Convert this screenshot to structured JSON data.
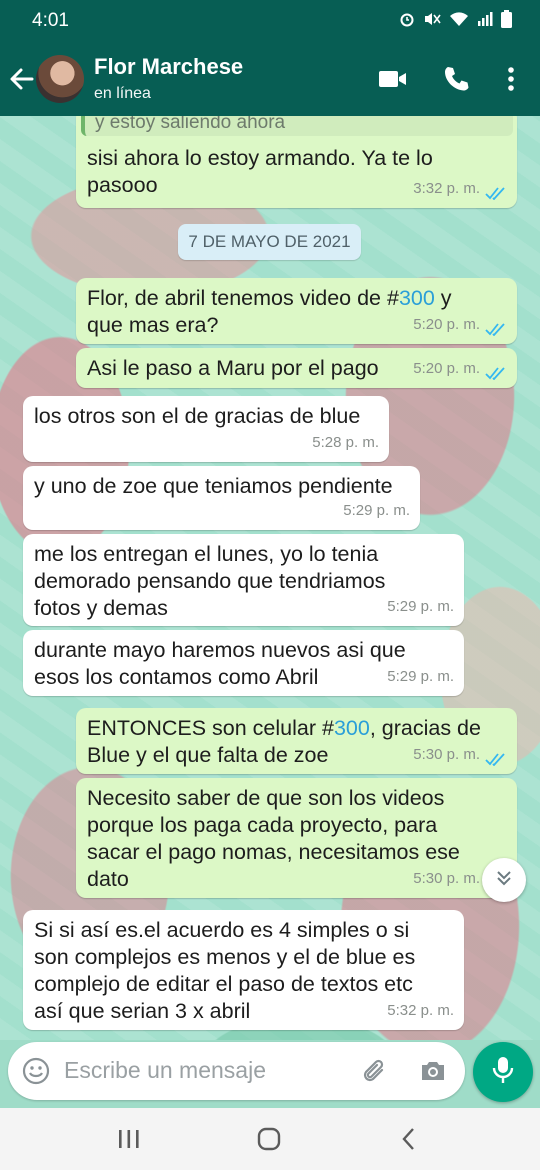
{
  "status_bar": {
    "time": "4:01"
  },
  "header": {
    "contact_name": "Flor Marchese",
    "contact_status": "en línea"
  },
  "messages": {
    "m0": {
      "quote": "y estoy saliendo ahora",
      "line1": "sisi ahora lo estoy armando. Ya te lo",
      "line2": "pasooo",
      "time": "3:32 p. m."
    },
    "date_chip": "7 DE MAYO DE 2021",
    "m1": {
      "pre": "Flor, de abril tenemos video de #",
      "num": "300",
      "post": " y",
      "line2": "que mas era?",
      "time": "5:20 p. m."
    },
    "m2": {
      "text": "Asi le paso a Maru por el pago",
      "time": "5:20 p. m."
    },
    "m3": {
      "text": "los otros son el de gracias de blue",
      "time": "5:28 p. m."
    },
    "m4": {
      "text": "y uno de zoe que teniamos pendiente",
      "time": "5:29 p. m."
    },
    "m5": {
      "line1": "me los entregan el lunes, yo lo tenia",
      "line2": "demorado pensando que tendriamos",
      "line3": "fotos y demas",
      "time": "5:29 p. m."
    },
    "m6": {
      "line1": "durante mayo haremos nuevos asi que",
      "line2": "esos los contamos como Abril",
      "time": "5:29 p. m."
    },
    "m7": {
      "pre": "ENTONCES son celular #",
      "num": "300",
      "post": ", gracias de",
      "line2": "Blue y el que falta de zoe",
      "time": "5:30 p. m."
    },
    "m8": {
      "line1": "Necesito saber de que son los videos",
      "line2": "porque los paga cada proyecto, para",
      "line3": "sacar el pago nomas, necesitamos ese",
      "line4": "dato",
      "time": "5:30 p. m."
    },
    "m9": {
      "line1": "Si si así es.el acuerdo es 4 simples o si",
      "line2": "son complejos es menos y el de blue es",
      "line3": "complejo de editar el paso de textos etc",
      "line4": "así que serian 3 x abril",
      "time": "5:32 p. m."
    }
  },
  "composer": {
    "placeholder": "Escribe un mensaje"
  },
  "colors": {
    "header": "#075e54",
    "outgoing": "#dcf8c6",
    "incoming": "#ffffff",
    "ticks": "#34b7f1",
    "mic": "#00a884"
  },
  "icons": [
    "back-arrow-icon",
    "video-call-icon",
    "phone-icon",
    "more-icon",
    "emoji-icon",
    "attach-icon",
    "camera-icon",
    "mic-icon",
    "scroll-down-icon"
  ]
}
